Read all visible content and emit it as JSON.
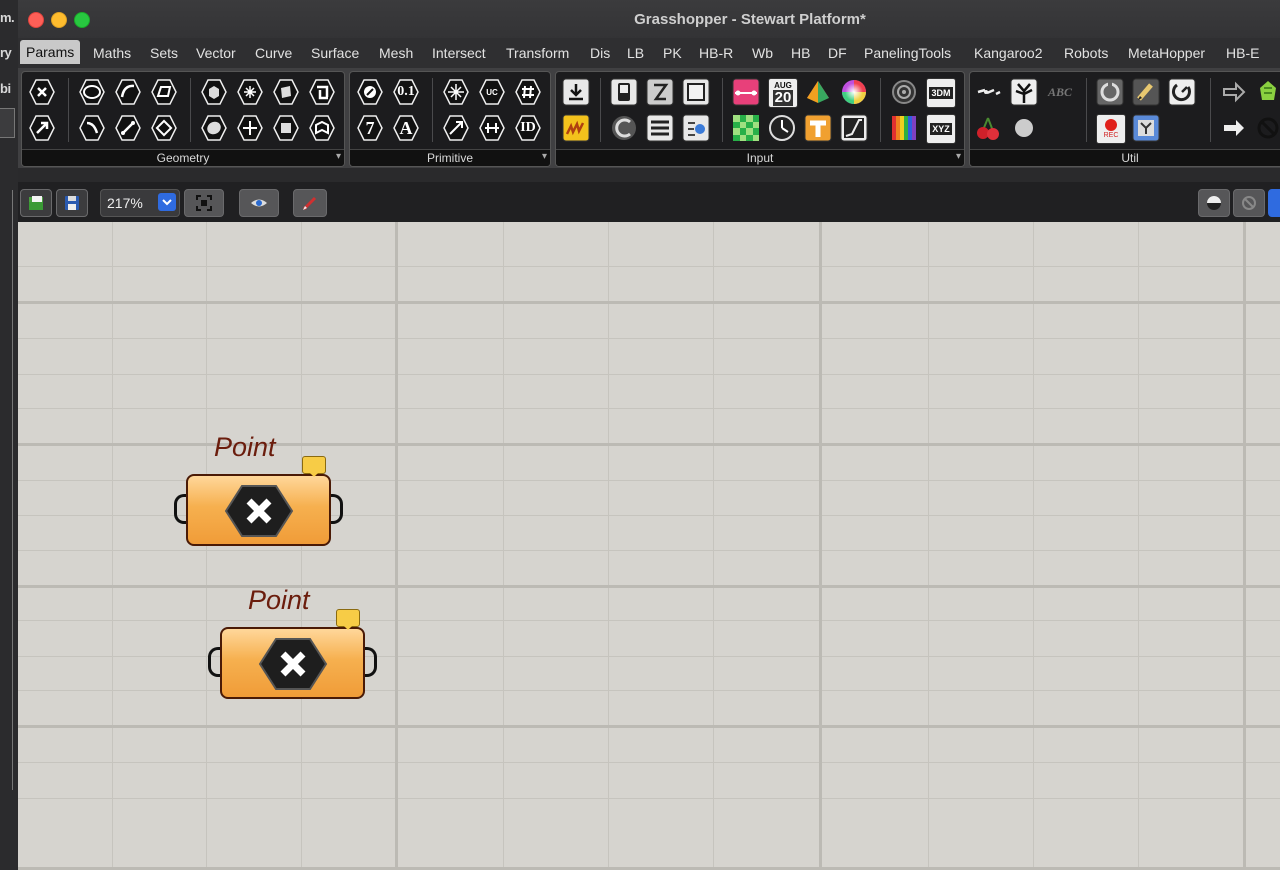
{
  "window": {
    "title": "Grasshopper - Stewart Platform*"
  },
  "left_fragments": [
    "m.",
    "ry",
    "bi"
  ],
  "menu": [
    "Params",
    "Maths",
    "Sets",
    "Vector",
    "Curve",
    "Surface",
    "Mesh",
    "Intersect",
    "Transform",
    "Dis",
    "LB",
    "PK",
    "HB-R",
    "Wb",
    "HB",
    "DF",
    "PanelingTools",
    "Kangaroo2",
    "Robots",
    "MetaHopper",
    "HB-E"
  ],
  "active_menu": "Params",
  "ribbon": {
    "panels": [
      {
        "label": "Geometry"
      },
      {
        "label": "Primitive"
      },
      {
        "label": "Input"
      },
      {
        "label": "Util"
      }
    ],
    "primitive_text_icons": {
      "decimal": "0.1",
      "integer": "7",
      "text": "A",
      "guid": "ID",
      "uc": "UC"
    },
    "calendar_icon": {
      "month": "AUG",
      "day": "20"
    },
    "file_icons": {
      "3dm": "3DM",
      "xyz": "XYZ",
      "rec": "REC",
      "abc": "ABC"
    }
  },
  "toolbar": {
    "zoom": "217%"
  },
  "canvas": {
    "components": [
      {
        "title": "Point",
        "icon": "point-param-icon"
      },
      {
        "title": "Point",
        "icon": "point-param-icon"
      }
    ]
  },
  "colors": {
    "canvas": "#d6d4cf",
    "component": "#f6b04f",
    "component_title": "#6b1d0d",
    "accent": "#2f6be0"
  }
}
